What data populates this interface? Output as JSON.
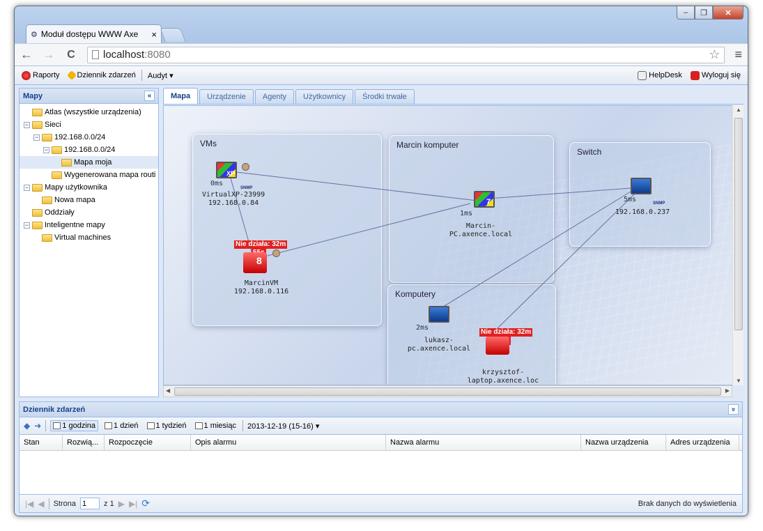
{
  "window": {
    "tab_title": "Moduł dostępu WWW Axe",
    "tab_close": "×",
    "minimize": "–",
    "maximize": "❐",
    "close": "✕"
  },
  "browser": {
    "url_host": "localhost",
    "url_port": ":8080",
    "back": "←",
    "forward": "→",
    "reload": "C",
    "star": "☆",
    "menu": "≡"
  },
  "menu": {
    "reports": "Raporty",
    "events_log": "Dziennik zdarzeń",
    "audit": "Audyt ▾",
    "helpdesk": "HelpDesk",
    "logout": "Wyloguj się"
  },
  "left_panel": {
    "title": "Mapy",
    "collapse": "«",
    "tree": [
      {
        "label": "Atlas (wszystkie urządzenia)",
        "indent": 0
      },
      {
        "label": "Sieci",
        "indent": 0,
        "exp": "−"
      },
      {
        "label": "192.168.0.0/24",
        "indent": 1,
        "exp": "−"
      },
      {
        "label": "192.168.0.0/24",
        "indent": 2,
        "exp": "−"
      },
      {
        "label": "Mapa moja",
        "indent": 3
      },
      {
        "label": "Wygenerowana mapa routi",
        "indent": 2
      },
      {
        "label": "Mapy użytkownika",
        "indent": 0,
        "exp": "−"
      },
      {
        "label": "Nowa mapa",
        "indent": 1
      },
      {
        "label": "Oddziały",
        "indent": 0
      },
      {
        "label": "Inteligentne mapy",
        "indent": 0,
        "exp": "−"
      },
      {
        "label": "Virtual machines",
        "indent": 1
      }
    ]
  },
  "tabs": [
    "Mapa",
    "Urządzenie",
    "Agenty",
    "Użytkownicy",
    "Środki trwałe"
  ],
  "map": {
    "groups": {
      "vms": "VMs",
      "marcin": "Marcin komputer",
      "switch": "Switch",
      "komputery": "Komputery"
    },
    "devices": {
      "virtualxp": {
        "name": "VirtualXP-23999",
        "ip": "192.168.0.84",
        "ms": "0ms",
        "snmp": "SNMP"
      },
      "marcinvm": {
        "name": "MarcinVM",
        "ip": "192.168.0.116",
        "error": "Nie działa: 32m",
        "err_time": "55s"
      },
      "marcinpc": {
        "name": "Marcin-",
        "name2": "PC.axence.local",
        "ms": "1ms"
      },
      "switch": {
        "ip": "192.168.0.237",
        "ms": "5ms",
        "snmp": "SNMP"
      },
      "lukasz": {
        "name": "lukasz-",
        "name2": "pc.axence.local",
        "ms": "2ms"
      },
      "krzysztof": {
        "name": "krzysztof-",
        "name2": "laptop.axence.loc",
        "error": "Nie działa: 32m",
        "err_time": "55s"
      }
    },
    "badge_xp": "XP",
    "badge_7": "7",
    "badge_8": "8"
  },
  "events": {
    "title": "Dziennik zdarzeń",
    "expand": "»",
    "ranges": [
      "1 godzina",
      "1 dzień",
      "1 tydzień",
      "1 miesiąc"
    ],
    "date": "2013-12-19 (15-16) ▾",
    "columns": [
      "Stan",
      "Rozwią...",
      "Rozpoczęcie",
      "Opis alarmu",
      "Nazwa alarmu",
      "Nazwa urządzenia",
      "Adres urządzenia"
    ],
    "pager": {
      "page_label": "Strona",
      "page_value": "1",
      "of": "z 1",
      "empty": "Brak danych do wyświetlenia"
    }
  },
  "colors": {
    "accent": "#15428b",
    "error": "#e02020"
  }
}
